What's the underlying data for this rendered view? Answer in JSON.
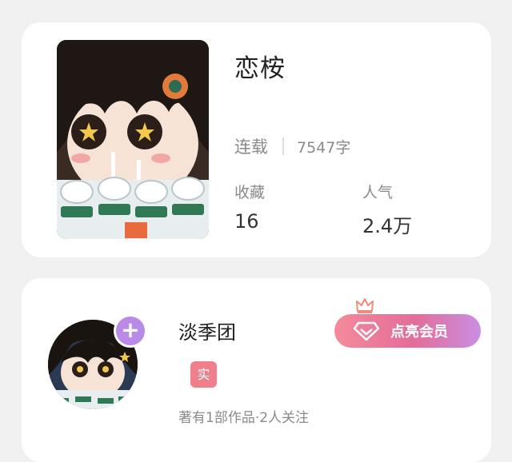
{
  "book": {
    "title": "恋桉",
    "status": "连载",
    "word_count": "7547字",
    "stats": [
      {
        "label": "收藏",
        "value": "16"
      },
      {
        "label": "人气",
        "value": "2.4万"
      }
    ]
  },
  "author": {
    "name": "淡季团",
    "follow_symbol": "+",
    "badge": "实",
    "meta": "著有1部作品·2人关注",
    "vip_label": "点亮会员"
  },
  "colors": {
    "background": "#f0f0f0",
    "card": "#ffffff",
    "follow_button": "#b98ae8",
    "badge": "#ef7f8a",
    "vip_gradient_start": "#f48a9b",
    "vip_gradient_end": "#c98ee3"
  },
  "icons": [
    "crown-icon",
    "diamond-icon",
    "plus-icon"
  ]
}
